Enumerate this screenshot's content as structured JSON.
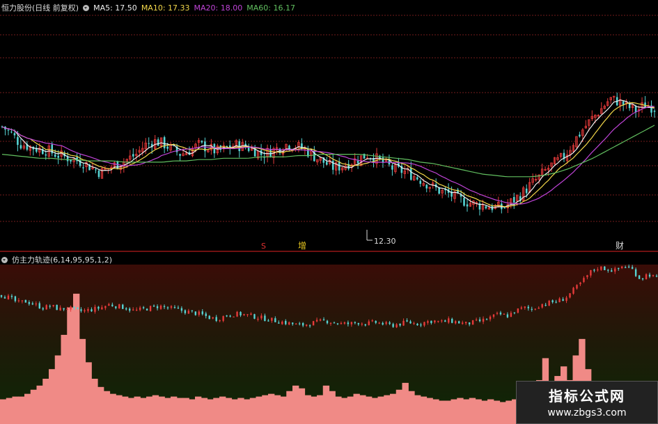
{
  "colors": {
    "up": "#e63a3a",
    "down": "#56d4d4",
    "ma5": "#f0f0f0",
    "ma10": "#f4d84a",
    "ma20": "#c044d8",
    "ma60": "#62c060",
    "histogram": "#f08a86",
    "grid": "#8a2020"
  },
  "header": {
    "stock": "恒力股份(日线 前复权)",
    "ma5": "MA5: 17.50",
    "ma10": "MA10: 17.33",
    "ma20": "MA20: 18.00",
    "ma60": "MA60: 16.17"
  },
  "indicator_header": {
    "name": "仿主力轨迹(6,14,95,95,1,2)"
  },
  "markers": {
    "s": "S",
    "zeng": "增",
    "cai": "财"
  },
  "watermark": {
    "title": "指标公式网",
    "url": "www.zbgs3.com"
  },
  "chart_data": [
    {
      "type": "candlestick",
      "series_names": [
        "MA5",
        "MA10",
        "MA20",
        "MA60"
      ],
      "min_label": "12.30",
      "close_trend": [
        19.7,
        19.2,
        18.4,
        18.2,
        18.0,
        17.9,
        17.6,
        17.4,
        17.2,
        17.0,
        16.6,
        16.2,
        16.6,
        16.9,
        17.2,
        17.6,
        18.3,
        18.6,
        18.4,
        18.0,
        17.6,
        17.9,
        18.3,
        18.1,
        17.8,
        18.0,
        18.3,
        18.2,
        18.0,
        17.6,
        17.8,
        18.1,
        18.4,
        18.2,
        17.9,
        17.4,
        17.0,
        16.6,
        16.7,
        17.0,
        17.3,
        17.6,
        17.2,
        16.8,
        16.4,
        16.3,
        16.0,
        15.6,
        15.2,
        14.8,
        14.6,
        14.2,
        14.0,
        13.8,
        13.7,
        13.6,
        13.5,
        14.0,
        14.5,
        15.2,
        15.8,
        16.5,
        17.0,
        17.5,
        18.6,
        19.5,
        20.3,
        21.0,
        21.8,
        21.6,
        21.2,
        20.9,
        21.4,
        21.1
      ],
      "ma60_trend": [
        17.6,
        17.5,
        17.4,
        17.3,
        17.3,
        17.2,
        17.2,
        17.1,
        17.1,
        17.1,
        17.0,
        17.0,
        17.0,
        17.0,
        17.1,
        17.1,
        17.2,
        17.2,
        17.3,
        17.3,
        17.3,
        17.4,
        17.4,
        17.4,
        17.5,
        17.5,
        17.6,
        17.6,
        17.6,
        17.6,
        17.5,
        17.4,
        17.3,
        17.2,
        17.0,
        16.9,
        16.7,
        16.5,
        16.3,
        16.1,
        16.0,
        15.9,
        15.9,
        15.9,
        16.0,
        16.2,
        16.5,
        16.9,
        17.3,
        17.8,
        18.3,
        18.8,
        19.3,
        19.8
      ]
    },
    {
      "type": "bar",
      "name": "仿主力轨迹",
      "values": [
        0.18,
        0.19,
        0.2,
        0.2,
        0.22,
        0.25,
        0.28,
        0.33,
        0.4,
        0.5,
        0.65,
        0.85,
        0.95,
        0.62,
        0.45,
        0.33,
        0.27,
        0.24,
        0.22,
        0.21,
        0.2,
        0.19,
        0.2,
        0.19,
        0.2,
        0.21,
        0.2,
        0.19,
        0.2,
        0.19,
        0.19,
        0.18,
        0.2,
        0.19,
        0.18,
        0.19,
        0.2,
        0.19,
        0.18,
        0.19,
        0.18,
        0.19,
        0.2,
        0.21,
        0.22,
        0.21,
        0.2,
        0.24,
        0.28,
        0.26,
        0.21,
        0.2,
        0.21,
        0.28,
        0.24,
        0.2,
        0.19,
        0.2,
        0.22,
        0.21,
        0.2,
        0.19,
        0.2,
        0.21,
        0.22,
        0.25,
        0.3,
        0.24,
        0.21,
        0.2,
        0.19,
        0.18,
        0.17,
        0.17,
        0.18,
        0.19,
        0.18,
        0.19,
        0.18,
        0.17,
        0.18,
        0.17,
        0.16,
        0.17,
        0.18,
        0.17,
        0.2,
        0.22,
        0.32,
        0.48,
        0.3,
        0.35,
        0.42,
        0.32,
        0.5,
        0.62,
        0.4,
        0.3,
        0.25,
        0.2,
        0.18,
        0.16,
        0.15,
        0.14,
        0.13,
        0.13,
        0.12,
        0.12
      ],
      "line_trend": [
        0.8,
        0.78,
        0.75,
        0.76,
        0.74,
        0.72,
        0.73,
        0.71,
        0.72,
        0.7,
        0.7,
        0.71,
        0.72,
        0.74,
        0.73,
        0.72,
        0.7,
        0.71,
        0.72,
        0.73,
        0.72,
        0.71,
        0.7,
        0.69,
        0.68,
        0.66,
        0.65,
        0.67,
        0.68,
        0.68,
        0.67,
        0.66,
        0.65,
        0.64,
        0.63,
        0.62,
        0.61,
        0.62,
        0.63,
        0.64,
        0.63,
        0.62,
        0.62,
        0.63,
        0.62,
        0.63,
        0.62,
        0.61,
        0.62,
        0.63,
        0.62,
        0.63,
        0.64,
        0.63,
        0.64,
        0.63,
        0.62,
        0.63,
        0.64,
        0.66,
        0.68,
        0.67,
        0.7,
        0.72,
        0.71,
        0.74,
        0.75,
        0.76,
        0.78,
        0.83,
        0.88,
        0.94,
        0.97,
        0.96,
        0.95,
        0.98,
        0.96,
        0.9,
        0.93,
        0.9
      ]
    }
  ]
}
